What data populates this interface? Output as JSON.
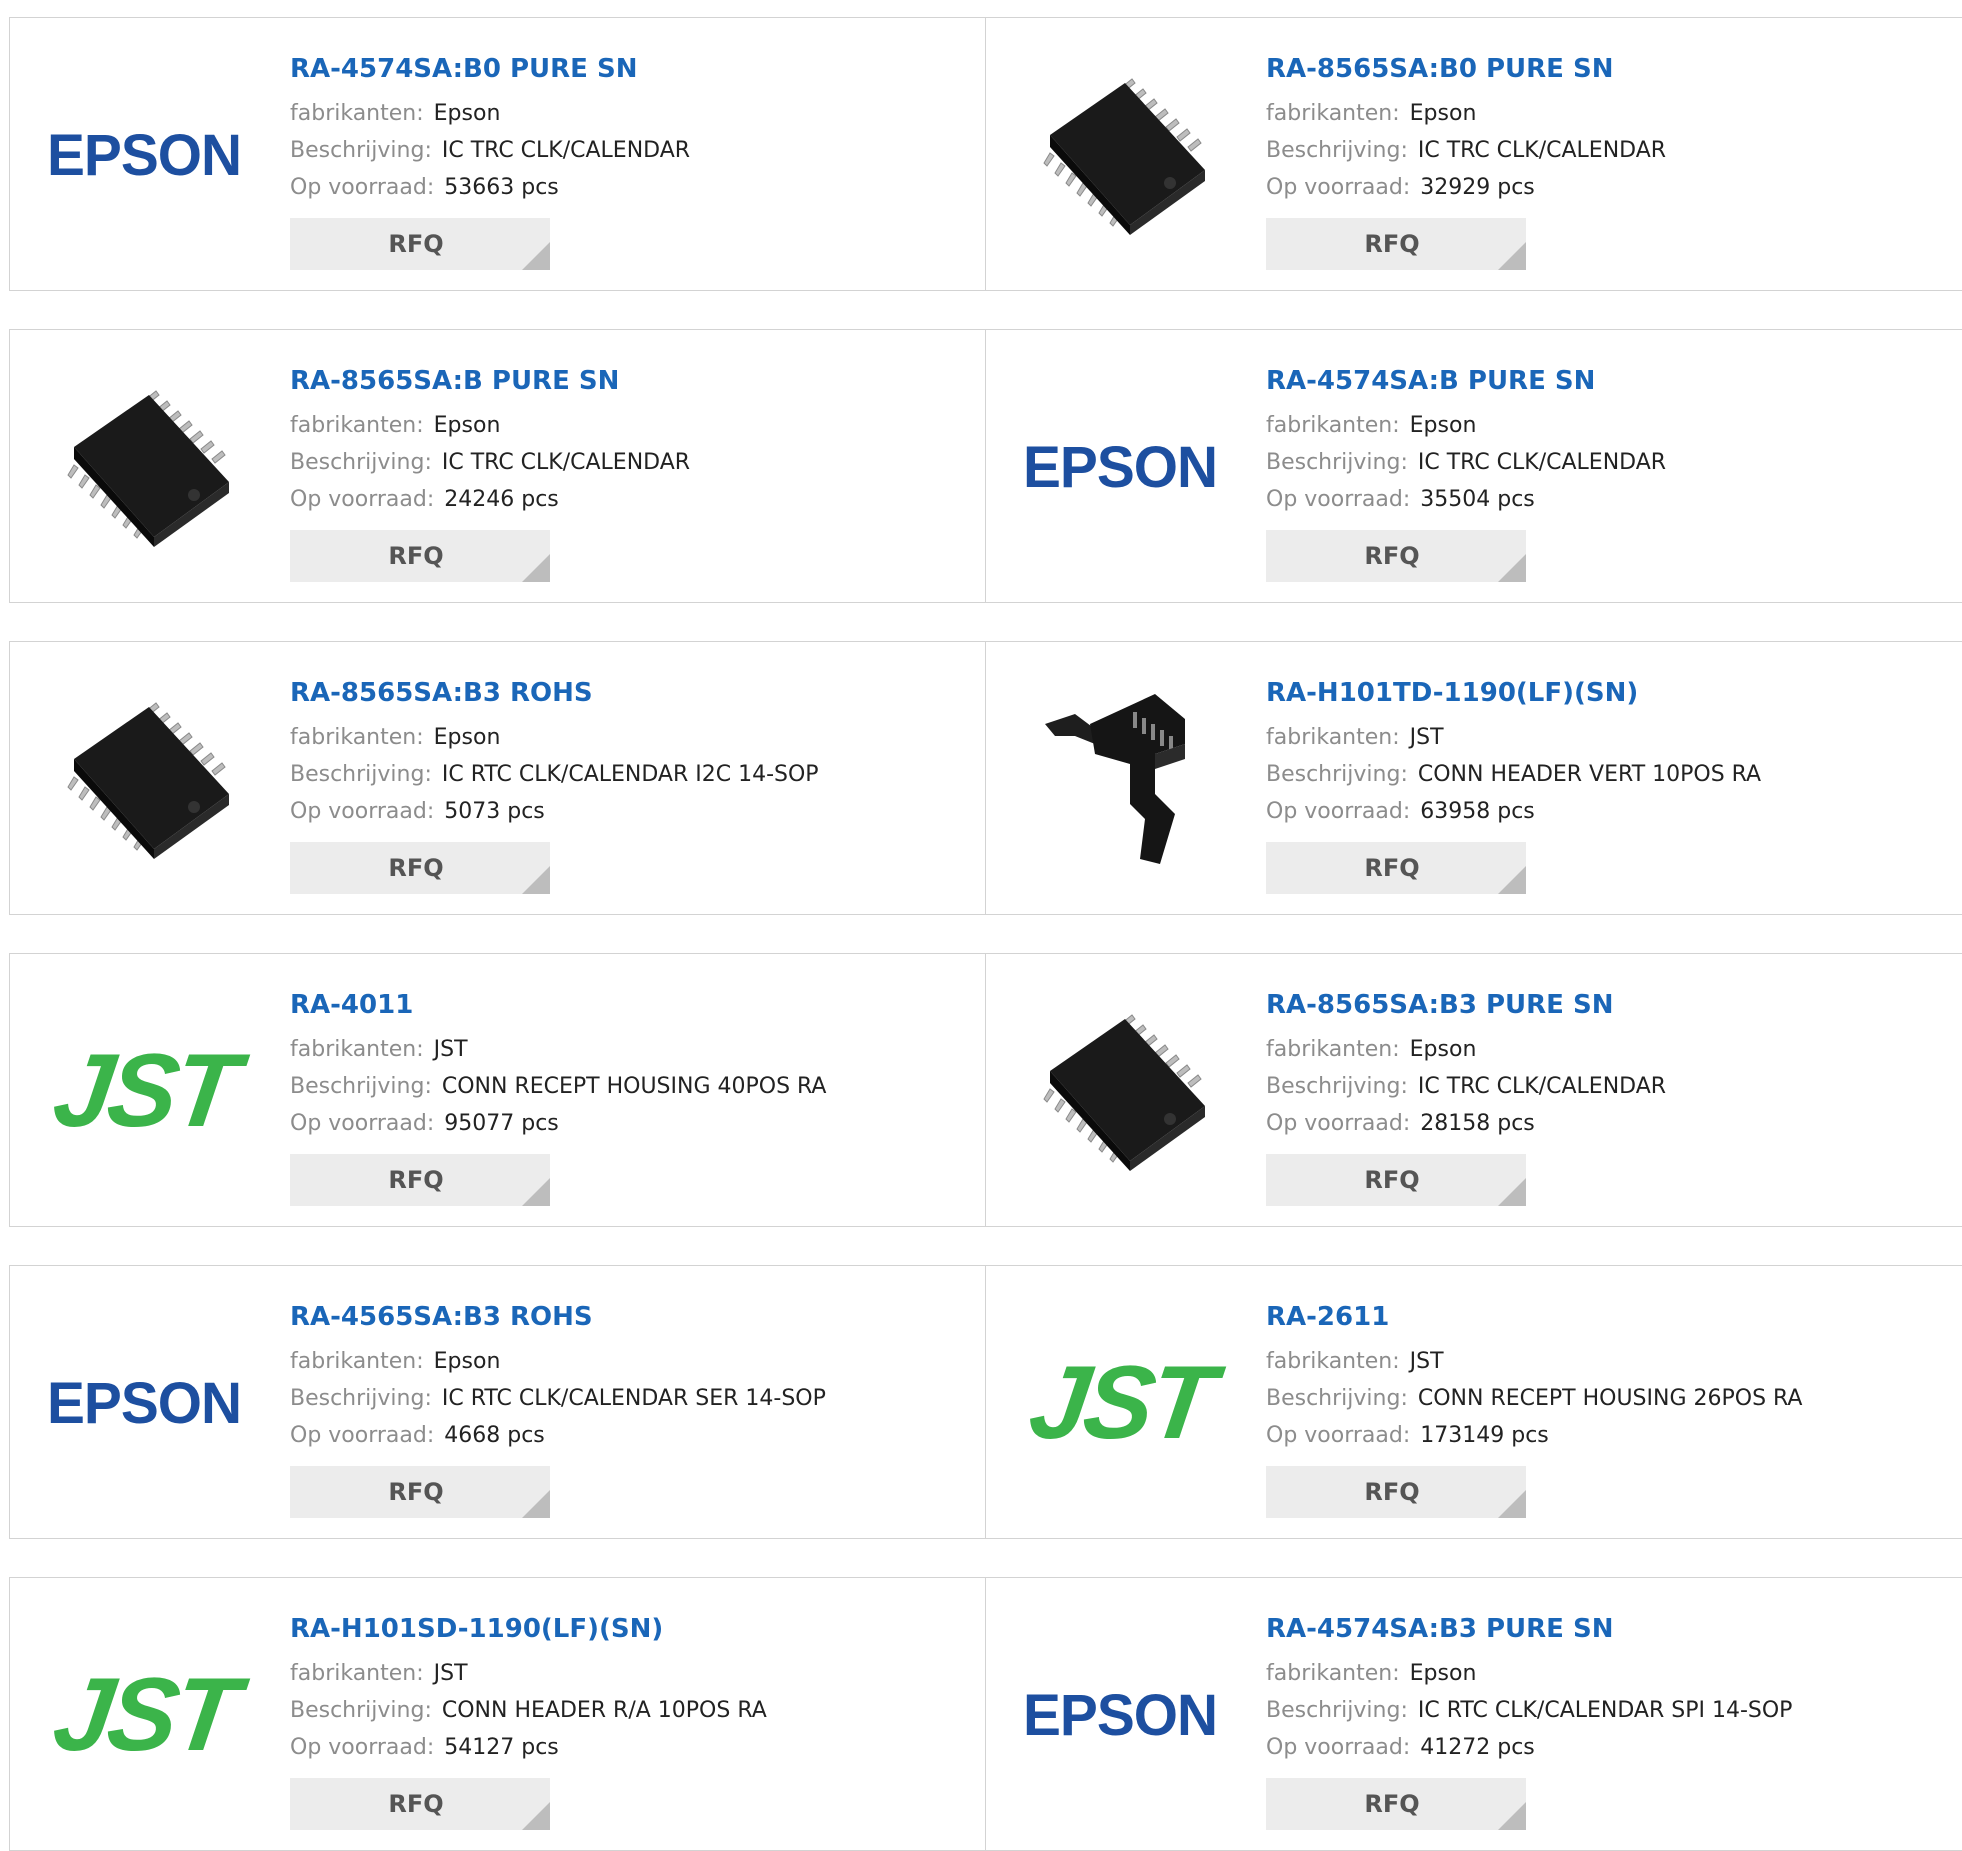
{
  "products": [
    {
      "part": "RA-4574SA:B0 PURE SN",
      "manufacturer": "Epson",
      "description": "IC TRC CLK/CALENDAR",
      "stock": "53663 pcs",
      "image": "epson-logo"
    },
    {
      "part": "RA-8565SA:B0 PURE SN",
      "manufacturer": "Epson",
      "description": "IC TRC CLK/CALENDAR",
      "stock": "32929 pcs",
      "image": "sop-chip"
    },
    {
      "part": "RA-8565SA:B PURE SN",
      "manufacturer": "Epson",
      "description": "IC TRC CLK/CALENDAR",
      "stock": "24246 pcs",
      "image": "sop-chip"
    },
    {
      "part": "RA-4574SA:B PURE SN",
      "manufacturer": "Epson",
      "description": "IC TRC CLK/CALENDAR",
      "stock": "35504 pcs",
      "image": "epson-logo"
    },
    {
      "part": "RA-8565SA:B3 ROHS",
      "manufacturer": "Epson",
      "description": "IC RTC CLK/CALENDAR I2C 14-SOP",
      "stock": "5073 pcs",
      "image": "sop-chip"
    },
    {
      "part": "RA-H101TD-1190(LF)(SN)",
      "manufacturer": "JST",
      "description": "CONN HEADER VERT 10POS RA",
      "stock": "63958 pcs",
      "image": "header-connector"
    },
    {
      "part": "RA-4011",
      "manufacturer": "JST",
      "description": "CONN RECEPT HOUSING 40POS RA",
      "stock": "95077 pcs",
      "image": "jst-logo"
    },
    {
      "part": "RA-8565SA:B3 PURE SN",
      "manufacturer": "Epson",
      "description": "IC TRC CLK/CALENDAR",
      "stock": "28158 pcs",
      "image": "sop-chip"
    },
    {
      "part": "RA-4565SA:B3 ROHS",
      "manufacturer": "Epson",
      "description": "IC RTC CLK/CALENDAR SER 14-SOP",
      "stock": "4668 pcs",
      "image": "epson-logo"
    },
    {
      "part": "RA-2611",
      "manufacturer": "JST",
      "description": "CONN RECEPT HOUSING 26POS RA",
      "stock": "173149 pcs",
      "image": "jst-logo"
    },
    {
      "part": "RA-H101SD-1190(LF)(SN)",
      "manufacturer": "JST",
      "description": "CONN HEADER R/A 10POS RA",
      "stock": "54127 pcs",
      "image": "jst-logo"
    },
    {
      "part": "RA-4574SA:B3 PURE SN",
      "manufacturer": "Epson",
      "description": "IC RTC CLK/CALENDAR SPI 14-SOP",
      "stock": "41272 pcs",
      "image": "epson-logo"
    }
  ],
  "labels": {
    "manufacturer": "fabrikanten:",
    "description": "Beschrijving:",
    "stock": "Op voorraad:",
    "rfq": "RFQ"
  },
  "logos": {
    "epson": "EPSON",
    "jst": "JST"
  },
  "colors": {
    "link": "#1a66b8",
    "label": "#8c8c8c",
    "epson": "#1d4fa0",
    "jst": "#3bb44a"
  }
}
